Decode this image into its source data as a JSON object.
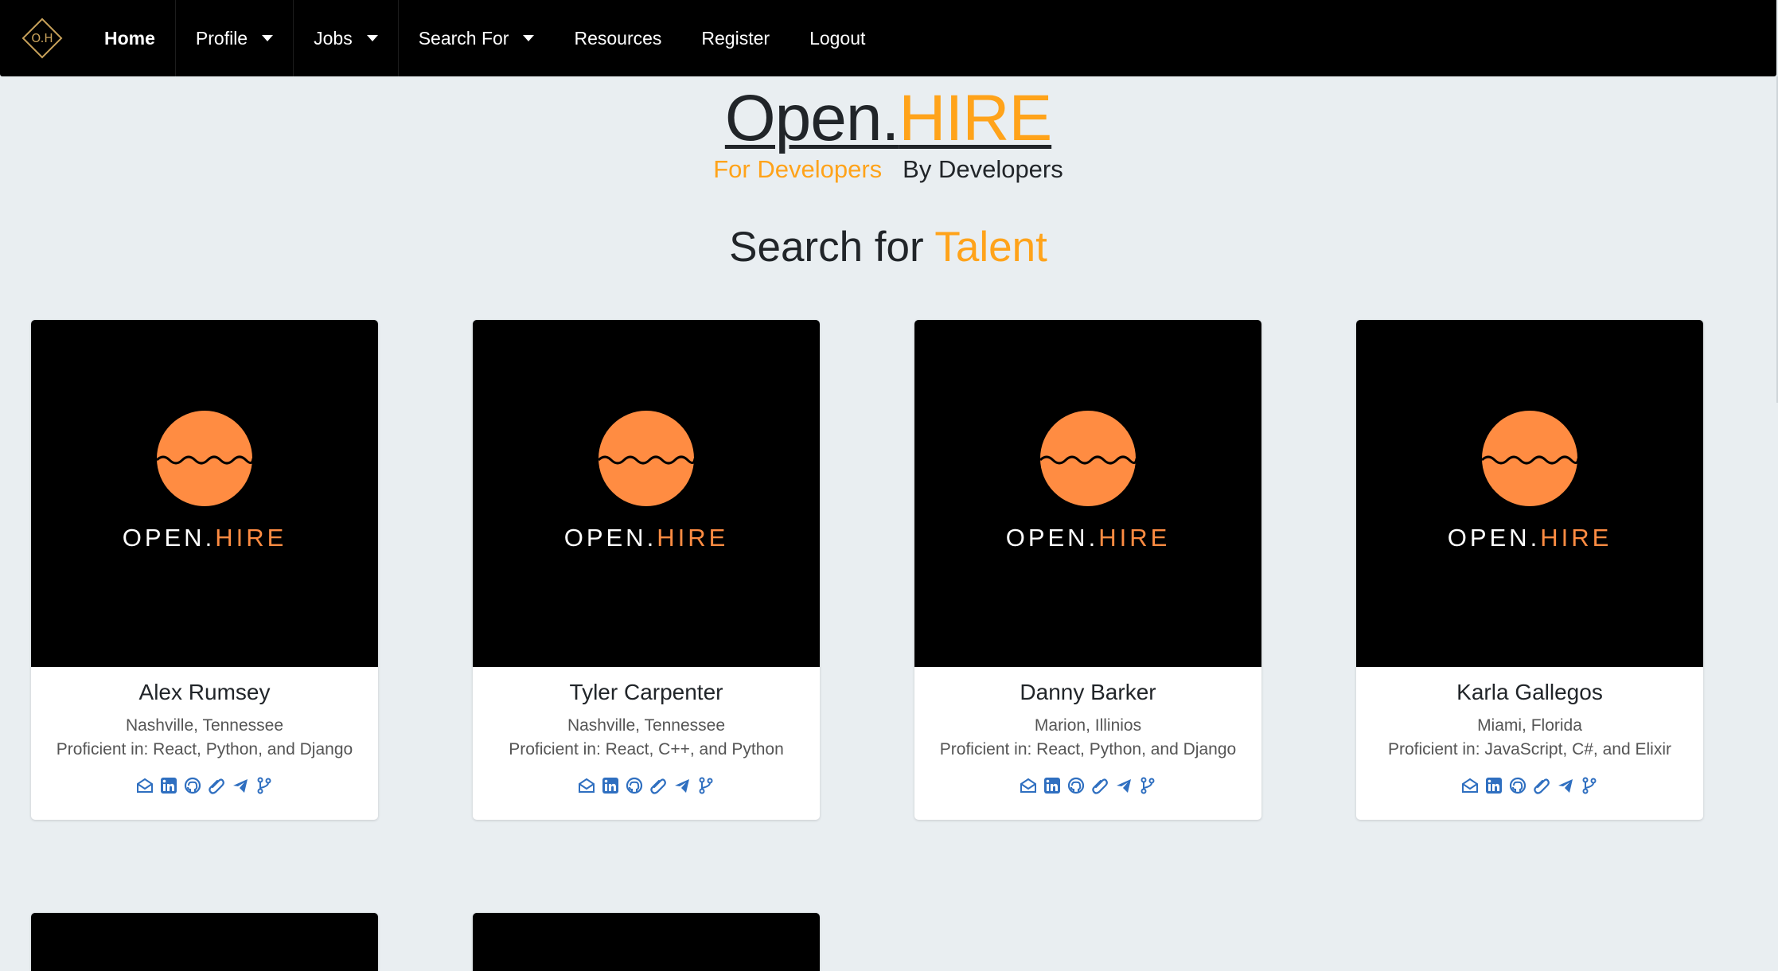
{
  "nav": {
    "brand_text": "O.H",
    "items": [
      {
        "label": "Home",
        "active": true,
        "dropdown": false
      },
      {
        "label": "Profile",
        "active": false,
        "dropdown": true
      },
      {
        "label": "Jobs",
        "active": false,
        "dropdown": true
      },
      {
        "label": "Search For",
        "active": false,
        "dropdown": true
      },
      {
        "label": "Resources",
        "active": false,
        "dropdown": false
      },
      {
        "label": "Register",
        "active": false,
        "dropdown": false
      },
      {
        "label": "Logout",
        "active": false,
        "dropdown": false
      }
    ]
  },
  "header": {
    "title_open": "Open.",
    "title_hire": "HIRE",
    "tagline_left": "For Developers",
    "tagline_right": "By Developers",
    "search_prefix": "Search for",
    "search_accent": "Talent"
  },
  "card_brand": {
    "word1": "OPEN.",
    "word2": "HIRE"
  },
  "cards": [
    {
      "name": "Alex Rumsey",
      "location": "Nashville, Tennessee",
      "proficiency": "Proficient in: React, Python, and Django"
    },
    {
      "name": "Tyler Carpenter",
      "location": "Nashville, Tennessee",
      "proficiency": "Proficient in: React, C++, and Python"
    },
    {
      "name": "Danny Barker",
      "location": "Marion, Illinios",
      "proficiency": "Proficient in: React, Python, and Django"
    },
    {
      "name": "Karla Gallegos",
      "location": "Miami, Florida",
      "proficiency": "Proficient in: JavaScript, C#, and Elixir"
    }
  ],
  "card_icons": [
    "envelope-icon",
    "linkedin-icon",
    "github-icon",
    "paperclip-icon",
    "telegram-icon",
    "git-branch-icon"
  ],
  "colors": {
    "accent": "#ffa31a",
    "logo_orange": "#ff8c42",
    "icon_blue": "#2f6fc0",
    "nav_bg": "#000000",
    "page_bg": "#e9eef1"
  }
}
